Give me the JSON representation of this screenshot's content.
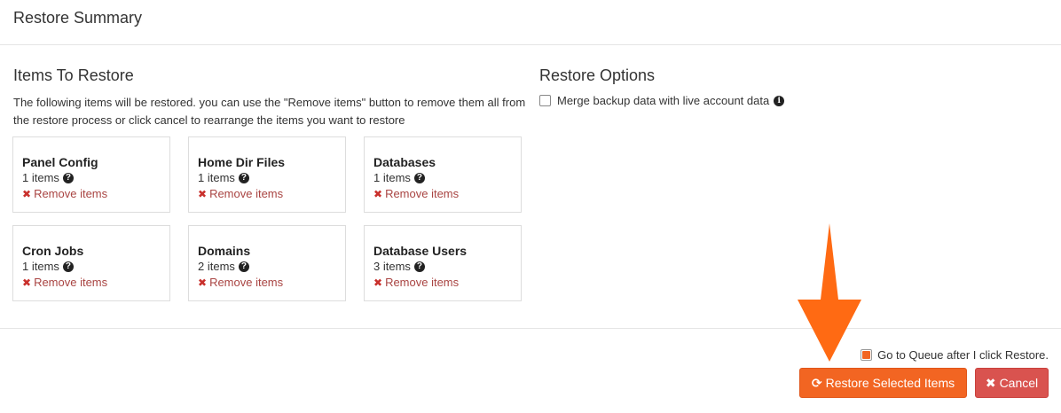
{
  "header": {
    "title": "Restore Summary"
  },
  "items_section": {
    "title": "Items To Restore",
    "description": "The following items will be restored. you can use the \"Remove items\" button to remove them all from the restore process or click cancel to rearrange the items you want to restore",
    "cards": [
      {
        "title": "Panel Config",
        "count": "1 items",
        "remove_label": "Remove items"
      },
      {
        "title": "Home Dir Files",
        "count": "1 items",
        "remove_label": "Remove items"
      },
      {
        "title": "Databases",
        "count": "1 items",
        "remove_label": "Remove items"
      },
      {
        "title": "Cron Jobs",
        "count": "1 items",
        "remove_label": "Remove items"
      },
      {
        "title": "Domains",
        "count": "2 items",
        "remove_label": "Remove items"
      },
      {
        "title": "Database Users",
        "count": "3 items",
        "remove_label": "Remove items"
      }
    ]
  },
  "options_section": {
    "title": "Restore Options",
    "merge_label": "Merge backup data with live account data",
    "merge_checked": false
  },
  "footer": {
    "queue_label": "Go to Queue after I click Restore.",
    "queue_checked": true,
    "restore_button": "Restore Selected Items",
    "cancel_button": "Cancel"
  },
  "icons": {
    "question": "question-circle-icon",
    "info": "info-circle-icon",
    "remove": "times-icon",
    "refresh": "refresh-icon",
    "arrow": "arrow-down-icon"
  },
  "colors": {
    "accent": "#f26522",
    "danger": "#d9534f",
    "remove_text": "#a94442"
  }
}
